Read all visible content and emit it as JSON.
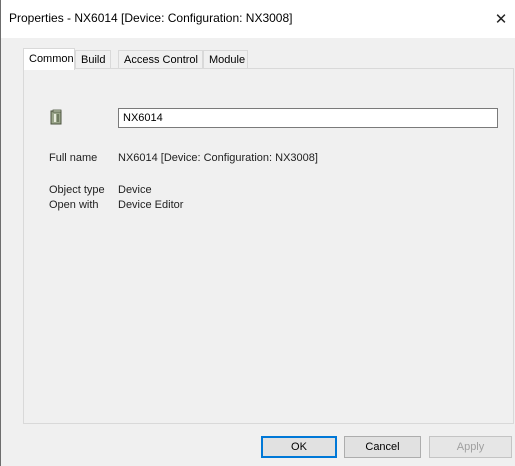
{
  "window": {
    "title": "Properties - NX6014 [Device: Configuration: NX3008]",
    "close_glyph": "✕"
  },
  "tabs": [
    {
      "label": "Common",
      "active": true
    },
    {
      "label": "Build",
      "active": false
    },
    {
      "label": "Access Control",
      "active": false
    },
    {
      "label": "Module",
      "active": false
    }
  ],
  "common": {
    "icon": "device-icon",
    "name_value": "NX6014",
    "full_name_label": "Full name",
    "full_name_value": "NX6014 [Device: Configuration: NX3008]",
    "object_type_label": "Object type",
    "object_type_value": "Device",
    "open_with_label": "Open with",
    "open_with_value": "Device Editor"
  },
  "buttons": {
    "ok": "OK",
    "cancel": "Cancel",
    "apply": "Apply"
  },
  "colors": {
    "default_button_border": "#0078d7",
    "dialog_background": "#f0f0f0"
  }
}
